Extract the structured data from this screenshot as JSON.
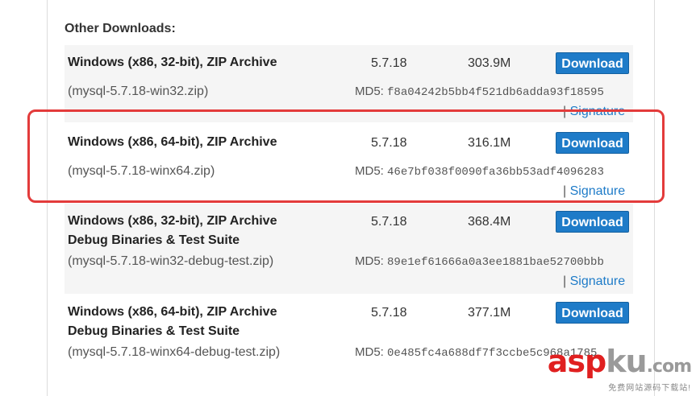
{
  "section": {
    "title": "Other Downloads:"
  },
  "rows": [
    {
      "name_line1": "Windows (x86, 32-bit), ZIP Archive",
      "name_line2": "",
      "filename": "(mysql-5.7.18-win32.zip)",
      "version": "5.7.18",
      "size": "303.9M",
      "button": "Download",
      "md5_label": "MD5:",
      "md5": "f8a04242b5bb4f521db6adda93f18595",
      "sig_sep": "|",
      "signature": "Signature"
    },
    {
      "name_line1": "Windows (x86, 64-bit), ZIP Archive",
      "name_line2": "",
      "filename": "(mysql-5.7.18-winx64.zip)",
      "version": "5.7.18",
      "size": "316.1M",
      "button": "Download",
      "md5_label": "MD5:",
      "md5": "46e7bf038f0090fa36bb53adf4096283",
      "sig_sep": "|",
      "signature": "Signature"
    },
    {
      "name_line1": "Windows (x86, 32-bit), ZIP Archive",
      "name_line2": "Debug Binaries & Test Suite",
      "filename": "(mysql-5.7.18-win32-debug-test.zip)",
      "version": "5.7.18",
      "size": "368.4M",
      "button": "Download",
      "md5_label": "MD5:",
      "md5": "89e1ef61666a0a3ee1881bae52700bbb",
      "sig_sep": "|",
      "signature": "Signature"
    },
    {
      "name_line1": "Windows (x86, 64-bit), ZIP Archive",
      "name_line2": "Debug Binaries & Test Suite",
      "filename": "(mysql-5.7.18-winx64-debug-test.zip)",
      "version": "5.7.18",
      "size": "377.1M",
      "button": "Download",
      "md5_label": "MD5:",
      "md5": "0e485fc4a688df7f3ccbe5c968a1785",
      "sig_sep": "",
      "signature": ""
    }
  ],
  "watermark": {
    "brand_red": "asp",
    "brand_grey": "ku",
    "brand_tld": ".com",
    "tagline": "免费网站源码下载站!"
  },
  "colors": {
    "button_blue": "#1e7bc8",
    "highlight_red": "#e33b3b",
    "row_shade": "#f5f5f5"
  }
}
